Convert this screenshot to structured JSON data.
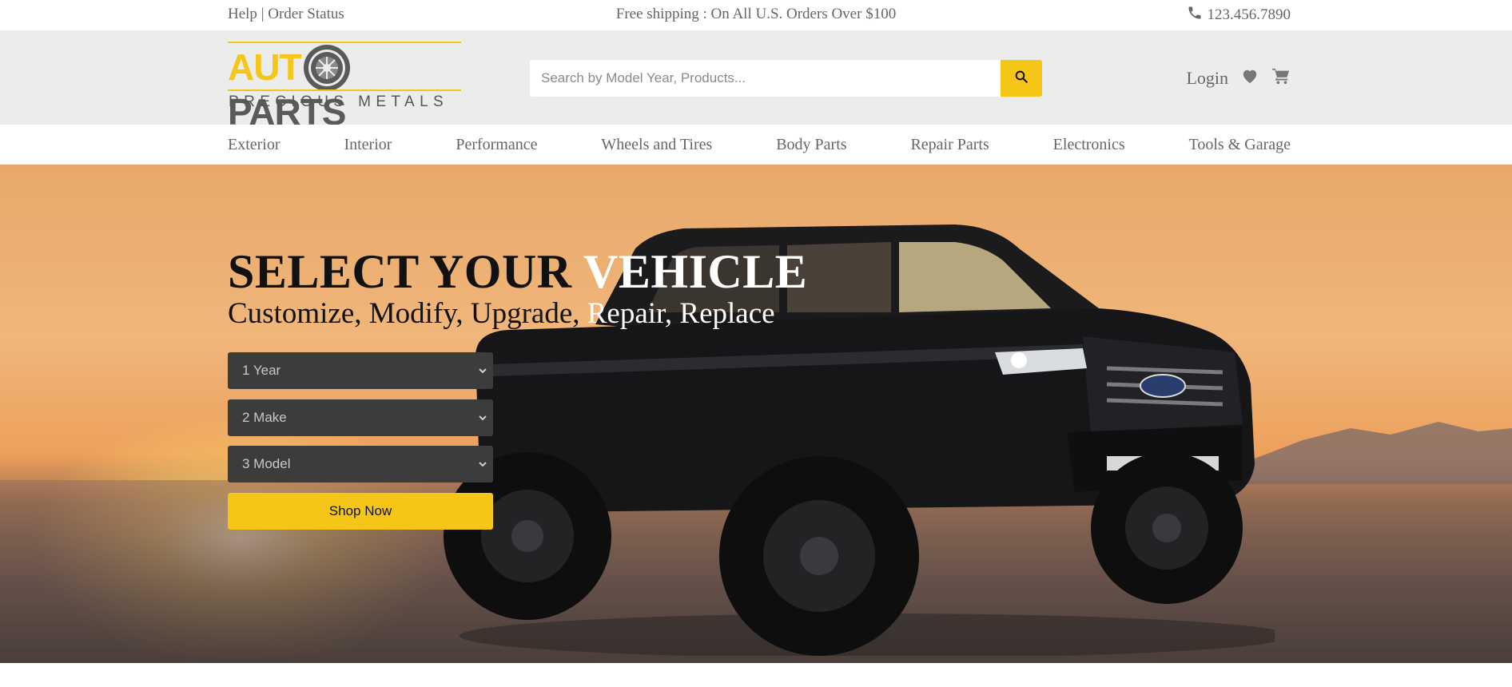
{
  "topbar": {
    "help": "Help",
    "separator": "|",
    "order_status": "Order Status",
    "shipping": "Free shipping : On All U.S. Orders Over $100",
    "phone": "123.456.7890",
    "phone_icon": "phone-icon"
  },
  "logo": {
    "word_left": "AUT",
    "word_right": "PARTS",
    "tagline": "PRECIOUS METALS",
    "icon": "gear-wheel-icon"
  },
  "search": {
    "placeholder": "Search by Model Year, Products...",
    "value": "",
    "button_icon": "search-icon"
  },
  "account": {
    "login": "Login",
    "wishlist_icon": "heart-icon",
    "cart_icon": "cart-icon"
  },
  "nav": {
    "items": [
      "Exterior",
      "Interior",
      "Performance",
      "Wheels and Tires",
      "Body Parts",
      "Repair Parts",
      "Electronics",
      "Tools & Garage"
    ]
  },
  "hero": {
    "title_dark": "SELECT YOUR ",
    "title_light": "VEHICLE",
    "subtitle_dark": "Customize, Modify, Upgrade, ",
    "subtitle_light": "Repair, Replace",
    "year_select": "1 Year",
    "make_select": "2 Make",
    "model_select": "3 Model",
    "shop_button": "Shop Now"
  },
  "colors": {
    "accent": "#f5c518",
    "select_bg": "#3a3d3b",
    "header_bg": "#ececec",
    "text_muted": "#666666"
  }
}
